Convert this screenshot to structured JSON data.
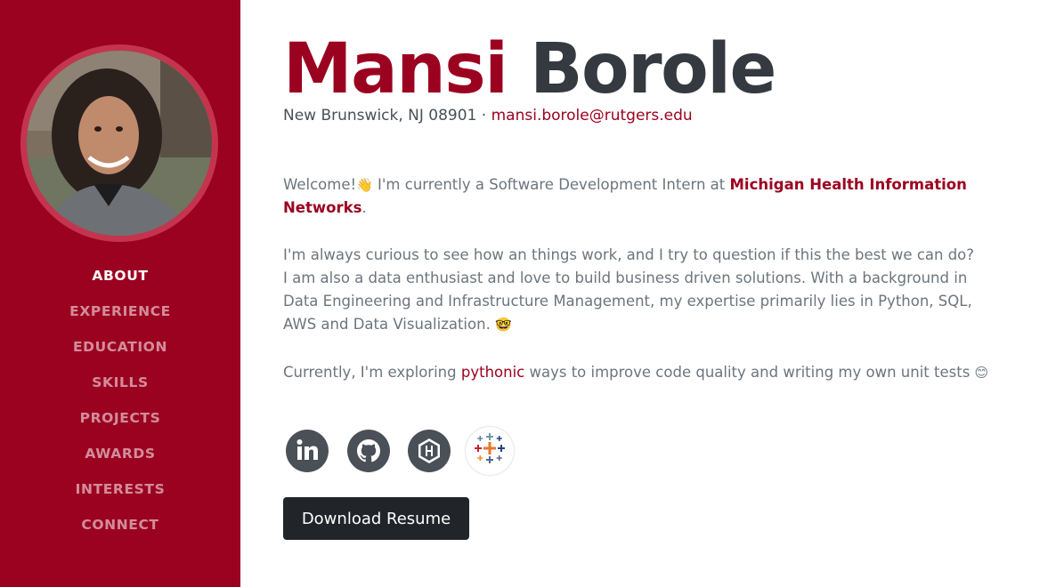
{
  "profile": {
    "first_name": "Mansi",
    "last_name": "Borole",
    "location": "New Brunswick, NJ 08901",
    "separator": " · ",
    "email": "mansi.borole@rutgers.edu",
    "avatar_alt": "profile-photo"
  },
  "sidebar": {
    "items": [
      {
        "label": "ABOUT",
        "active": true
      },
      {
        "label": "EXPERIENCE",
        "active": false
      },
      {
        "label": "EDUCATION",
        "active": false
      },
      {
        "label": "SKILLS",
        "active": false
      },
      {
        "label": "PROJECTS",
        "active": false
      },
      {
        "label": "AWARDS",
        "active": false
      },
      {
        "label": "INTERESTS",
        "active": false
      },
      {
        "label": "CONNECT",
        "active": false
      }
    ]
  },
  "about": {
    "p1_a": "Welcome!",
    "p1_wave": "👋",
    "p1_b": " I'm currently a Software Development Intern at ",
    "p1_company": "Michigan Health Information Networks",
    "p1_c": ".",
    "p2_line1": "I'm always curious to see how an things work, and I try to question if this the best we can do?",
    "p2_line2": "I am also a data enthusiast and love to build business driven solutions. With a background in Data Engineering and Infrastructure Management, my expertise primarily lies in Python, SQL, AWS and Data Visualization.",
    "p2_emoji": "🤓",
    "p3_a": "Currently, I'm exploring ",
    "p3_link": "pythonic",
    "p3_b": " ways to improve code quality and writing my own unit tests ",
    "p3_emoji": "😊"
  },
  "social": [
    {
      "name": "linkedin",
      "icon": "linkedin-icon"
    },
    {
      "name": "github",
      "icon": "github-icon"
    },
    {
      "name": "hackerrank",
      "icon": "hackerrank-icon"
    },
    {
      "name": "tableau",
      "icon": "tableau-icon"
    }
  ],
  "actions": {
    "download_label": "Download Resume"
  },
  "colors": {
    "primary": "#9b0220",
    "dark": "#343a40",
    "muted": "#6c757d"
  }
}
